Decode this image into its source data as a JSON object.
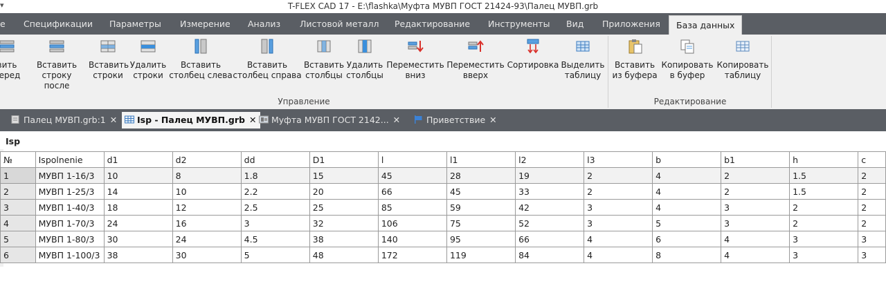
{
  "window": {
    "title": "T-FLEX CAD 17 - E:\\flashka\\Муфта МУВП ГОСТ 21424-93\\Палец МУВП.grb",
    "quick_access": "▾"
  },
  "menu_tabs": [
    {
      "label": "е",
      "active": false
    },
    {
      "label": "Спецификации",
      "active": false
    },
    {
      "label": "Параметры",
      "active": false
    },
    {
      "label": "Измерение",
      "active": false
    },
    {
      "label": "Анализ",
      "active": false
    },
    {
      "label": "Листовой металл",
      "active": false
    },
    {
      "label": "Редактирование",
      "active": false
    },
    {
      "label": "Инструменты",
      "active": false
    },
    {
      "label": "Вид",
      "active": false
    },
    {
      "label": "Приложения",
      "active": false
    },
    {
      "label": "База данных",
      "active": true
    }
  ],
  "ribbon": {
    "buttons": [
      {
        "line1": "вить",
        "line2": "перед",
        "icon": "insert-row-before-icon"
      },
      {
        "line1": "Вставить",
        "line2": "строку после",
        "icon": "insert-row-after-icon"
      },
      {
        "line1": "Вставить",
        "line2": "строки",
        "icon": "insert-rows-icon"
      },
      {
        "line1": "Удалить",
        "line2": "строки",
        "icon": "delete-rows-icon"
      },
      {
        "line1": "Вставить",
        "line2": "столбец слева",
        "icon": "insert-column-left-icon"
      },
      {
        "line1": "Вставить",
        "line2": "столбец справа",
        "icon": "insert-column-right-icon"
      },
      {
        "line1": "Вставить",
        "line2": "столбцы",
        "icon": "insert-columns-icon"
      },
      {
        "line1": "Удалить",
        "line2": "столбцы",
        "icon": "delete-columns-icon"
      },
      {
        "line1": "Переместить",
        "line2": "вниз",
        "icon": "move-down-icon"
      },
      {
        "line1": "Переместить",
        "line2": "вверх",
        "icon": "move-up-icon"
      },
      {
        "line1": "Сортировка",
        "line2": "",
        "icon": "sort-icon"
      },
      {
        "line1": "Выделить",
        "line2": "таблицу",
        "icon": "select-table-icon"
      },
      {
        "line1": "Вставить",
        "line2": "из буфера",
        "icon": "paste-icon"
      },
      {
        "line1": "Копировать",
        "line2": "в буфер",
        "icon": "copy-icon"
      },
      {
        "line1": "Копировать",
        "line2": "таблицу",
        "icon": "copy-table-icon"
      }
    ],
    "groups": [
      {
        "label": "Управление"
      },
      {
        "label": "Редактирование"
      }
    ]
  },
  "doc_tabs": [
    {
      "label": "Палец МУВП.grb:1",
      "icon": "drawing-doc-icon",
      "active": false
    },
    {
      "label": "Isp - Палец МУВП.grb",
      "icon": "table-doc-icon",
      "active": true
    },
    {
      "label": "Муфта МУВП ГОСТ 2142...",
      "icon": "assembly-doc-icon",
      "active": false
    },
    {
      "label": "Приветствие",
      "icon": "welcome-flag-icon",
      "active": false
    }
  ],
  "close_glyph": "✕",
  "sheet": {
    "name": "Isp",
    "columns": [
      "№",
      "Ispolnenie",
      "d1",
      "d2",
      "dd",
      "D1",
      "l",
      "l1",
      "l2",
      "l3",
      "b",
      "b1",
      "h",
      "c"
    ],
    "rows": [
      [
        "1",
        "МУВП 1-16/3",
        "10",
        "8",
        "1.8",
        "15",
        "45",
        "28",
        "19",
        "2",
        "4",
        "2",
        "1.5",
        "2"
      ],
      [
        "2",
        "МУВП 1-25/3",
        "14",
        "10",
        "2.2",
        "20",
        "66",
        "45",
        "33",
        "2",
        "4",
        "2",
        "1.5",
        "2"
      ],
      [
        "3",
        "МУВП 1-40/3",
        "18",
        "12",
        "2.5",
        "25",
        "85",
        "59",
        "42",
        "3",
        "4",
        "3",
        "2",
        "2"
      ],
      [
        "4",
        "МУВП 1-70/3",
        "24",
        "16",
        "3",
        "32",
        "106",
        "75",
        "52",
        "3",
        "5",
        "3",
        "2",
        "2"
      ],
      [
        "5",
        "МУВП 1-80/3",
        "30",
        "24",
        "4.5",
        "38",
        "140",
        "95",
        "66",
        "4",
        "6",
        "4",
        "3",
        "3"
      ],
      [
        "6",
        "МУВП 1-100/3",
        "38",
        "30",
        "5",
        "48",
        "172",
        "119",
        "84",
        "4",
        "8",
        "4",
        "3",
        "3"
      ]
    ]
  }
}
